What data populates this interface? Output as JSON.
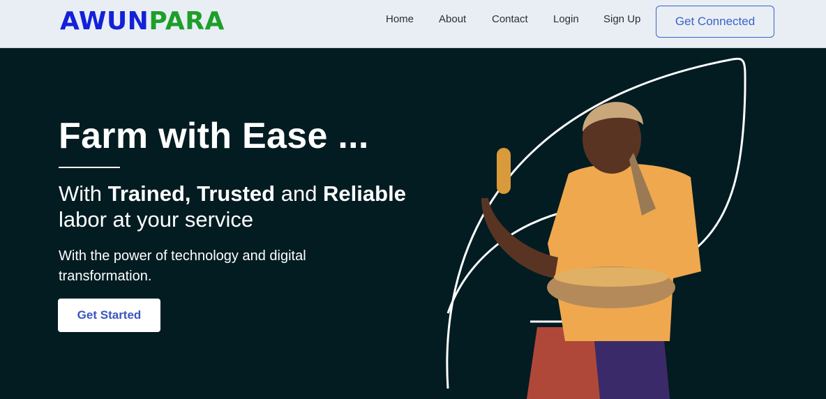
{
  "brand": {
    "part1": "AWUN",
    "part2": "PARA"
  },
  "nav": {
    "links": [
      "Home",
      "About",
      "Contact",
      "Login",
      "Sign Up"
    ],
    "cta": "Get Connected"
  },
  "hero": {
    "headline": "Farm with Ease ...",
    "sub_prefix": "With ",
    "sub_b1": "Trained,",
    "sub_mid1": " ",
    "sub_b2": "Trusted",
    "sub_mid2": " and ",
    "sub_b3": "Reliable",
    "sub_suffix": " labor at your service",
    "tagline": "With the power of technology and digital transformation.",
    "button": "Get Started"
  },
  "colors": {
    "brand_blue": "#1321d8",
    "brand_green": "#1e9e2a",
    "hero_bg": "#021c22",
    "accent": "#3a63c7"
  }
}
